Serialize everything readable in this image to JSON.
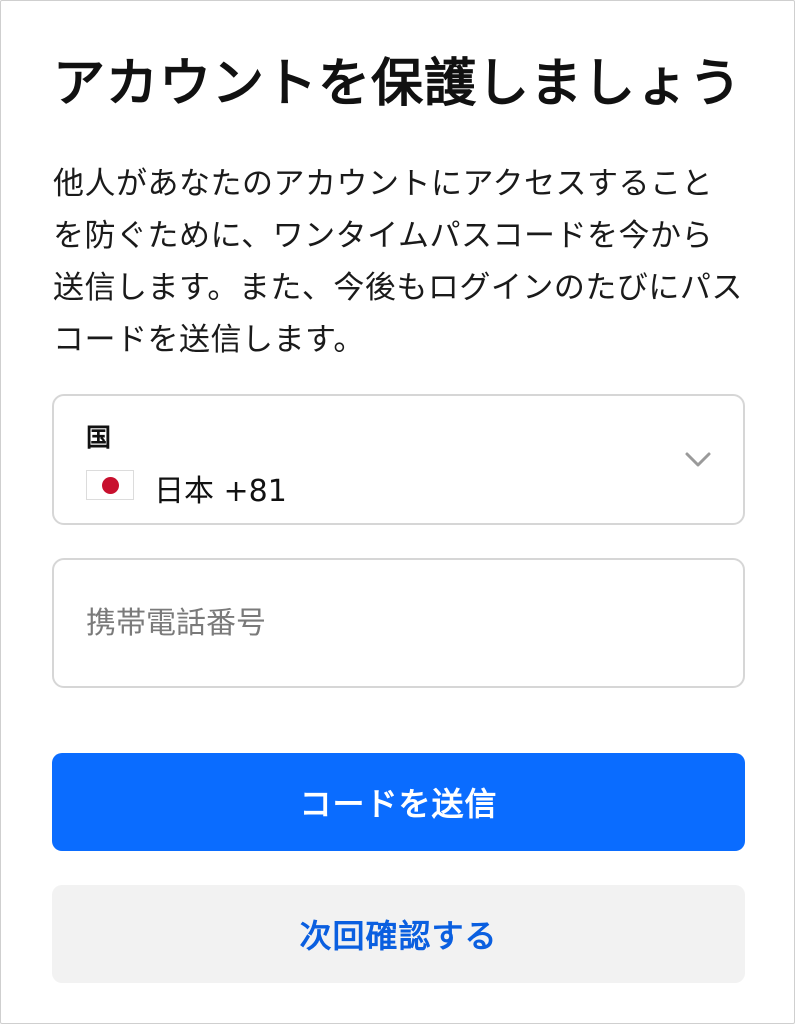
{
  "header": {
    "title": "アカウントを保護しましょう"
  },
  "description": "他人があなたのアカウントにアクセスすることを防ぐために、ワンタイムパスコードを今から送信します。また、今後もログインのたびにパスコードを送信します。",
  "country": {
    "label": "国",
    "value": "日本 +81",
    "flag_icon": "japan-flag-icon",
    "flag_color": "#c8102e"
  },
  "phone": {
    "placeholder": "携帯電話番号",
    "value": ""
  },
  "buttons": {
    "send_code": "コードを送信",
    "verify_later": "次回確認する"
  },
  "colors": {
    "primary": "#0a6cff",
    "secondary_bg": "#f2f2f2",
    "secondary_text": "#0a5fe0"
  }
}
